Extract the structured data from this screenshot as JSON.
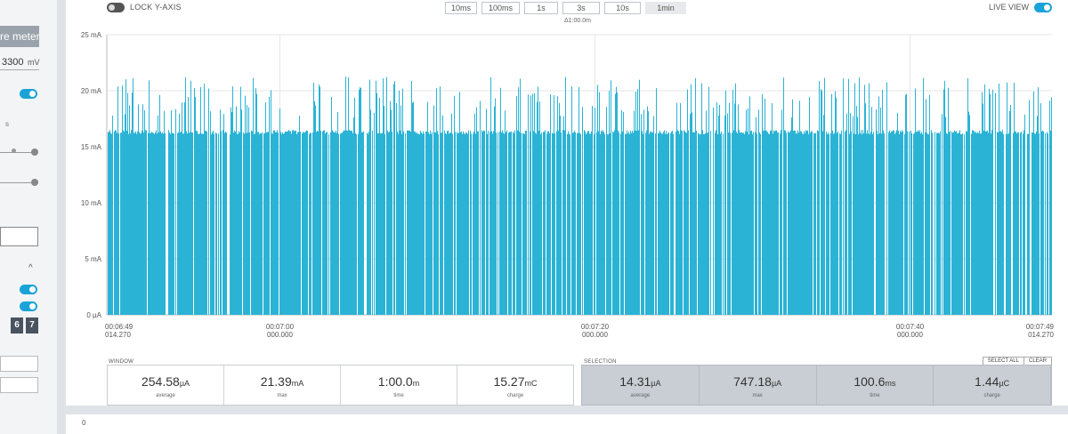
{
  "sidebar": {
    "mode_button": "re meter",
    "voltage_value": "3300",
    "voltage_unit": "mV",
    "sample_text": "s",
    "digits": [
      "6",
      "7"
    ],
    "chevron": "^"
  },
  "toolbar": {
    "lock_label": "LOCK Y-AXIS",
    "live_label": "LIVE VIEW",
    "window_buttons": [
      "10ms",
      "100ms",
      "1s",
      "3s",
      "10s",
      "1min"
    ],
    "active_window": "1min",
    "delta": "Δ1:00.0m"
  },
  "chart_data": {
    "type": "bar",
    "ylabel": "",
    "ylim": [
      0,
      25
    ],
    "yticks": [
      "0 µA",
      "5 mA",
      "10 mA",
      "15 mA",
      "20 mA",
      "25 mA"
    ],
    "ytick_values": [
      0,
      5,
      10,
      15,
      20,
      25
    ],
    "xticks": [
      {
        "time": "00:06:49",
        "frac": "014.270"
      },
      {
        "time": "00:07:00",
        "frac": "000.000"
      },
      {
        "time": "00:07:20",
        "frac": "000.000"
      },
      {
        "time": "00:07:40",
        "frac": "000.000"
      },
      {
        "time": "00:07:49",
        "frac": "014.270"
      }
    ],
    "x_range": [
      "00:06:49.014270",
      "00:07:49.014270"
    ],
    "xtick_seconds": [
      0,
      10.986,
      30.986,
      50.986,
      60
    ],
    "base_level_mA": 16.1,
    "peak_max_mA": 21.39,
    "series_color": "#2bb3d5",
    "grid": true
  },
  "window_stats": {
    "title": "WINDOW",
    "items": [
      {
        "value": "254.58",
        "unit": "µA",
        "label": "average"
      },
      {
        "value": "21.39",
        "unit": "mA",
        "label": "max"
      },
      {
        "value": "1:00.0",
        "unit": "m",
        "label": "time"
      },
      {
        "value": "15.27",
        "unit": "mC",
        "label": "charge"
      }
    ]
  },
  "selection_stats": {
    "title": "SELECTION",
    "select_all": "SELECT ALL",
    "clear": "CLEAR",
    "items": [
      {
        "value": "14.31",
        "unit": "µA",
        "label": "average"
      },
      {
        "value": "747.18",
        "unit": "µA",
        "label": "max"
      },
      {
        "value": "100.6",
        "unit": "ms",
        "label": "time"
      },
      {
        "value": "1.44",
        "unit": "µC",
        "label": "charge"
      }
    ]
  },
  "log": {
    "first_line": "0"
  },
  "colors": {
    "accent": "#1aa3d8",
    "bar": "#2bb3d5"
  }
}
